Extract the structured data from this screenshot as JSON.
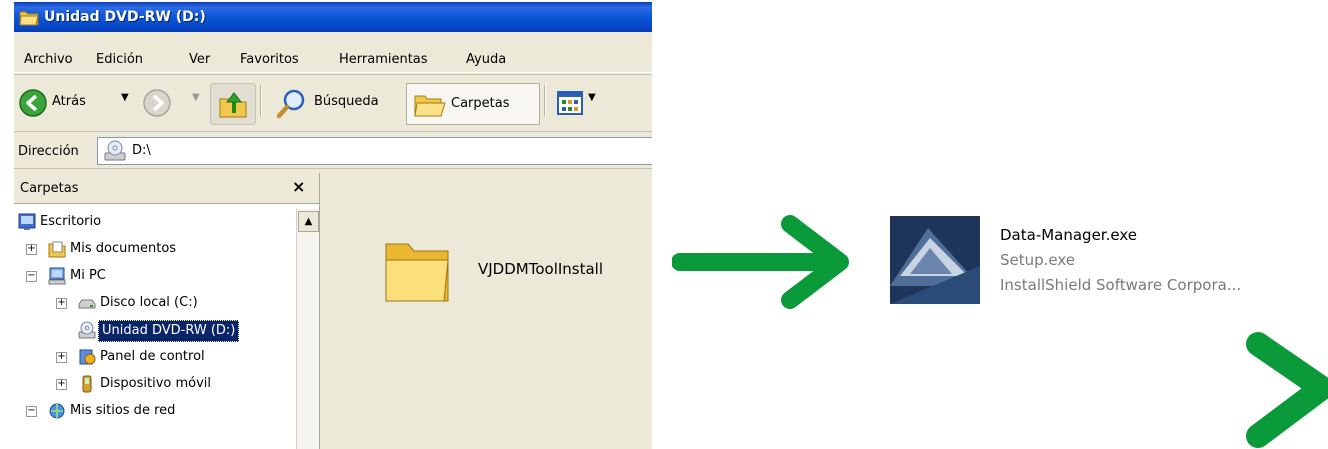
{
  "window": {
    "title": "Unidad DVD-RW (D:)",
    "menu": [
      "Archivo",
      "Edición",
      "Ver",
      "Favoritos",
      "Herramientas",
      "Ayuda"
    ],
    "toolbar": {
      "back": "Atrás",
      "search": "Búsqueda",
      "folders": "Carpetas"
    },
    "address": {
      "label": "Dirección",
      "value": "D:\\"
    }
  },
  "pane": {
    "title": "Carpetas",
    "close": "×",
    "items": [
      {
        "label": "Escritorio",
        "icon": "desktop-icon"
      },
      {
        "label": "Mis documentos",
        "icon": "documents-icon"
      },
      {
        "label": "Mi PC",
        "icon": "computer-icon"
      },
      {
        "label": "Disco local (C:)",
        "icon": "harddrive-icon"
      },
      {
        "label": "Unidad DVD-RW (D:)",
        "icon": "dvd-drive-icon",
        "selected": true
      },
      {
        "label": "Panel de control",
        "icon": "control-panel-icon"
      },
      {
        "label": "Dispositivo móvil",
        "icon": "mobile-device-icon"
      },
      {
        "label": "Mis sitios de red",
        "icon": "network-icon"
      }
    ]
  },
  "content": {
    "folder": {
      "name": "VJDDMToolInstall"
    },
    "installer": {
      "name": "Data-Manager.exe",
      "description": "Setup.exe",
      "company": "InstallShield Software Corpora..."
    }
  },
  "colors": {
    "arrow": "#0a9a3a",
    "selection": "#0a246a",
    "titlebar": "#0b57d8"
  }
}
